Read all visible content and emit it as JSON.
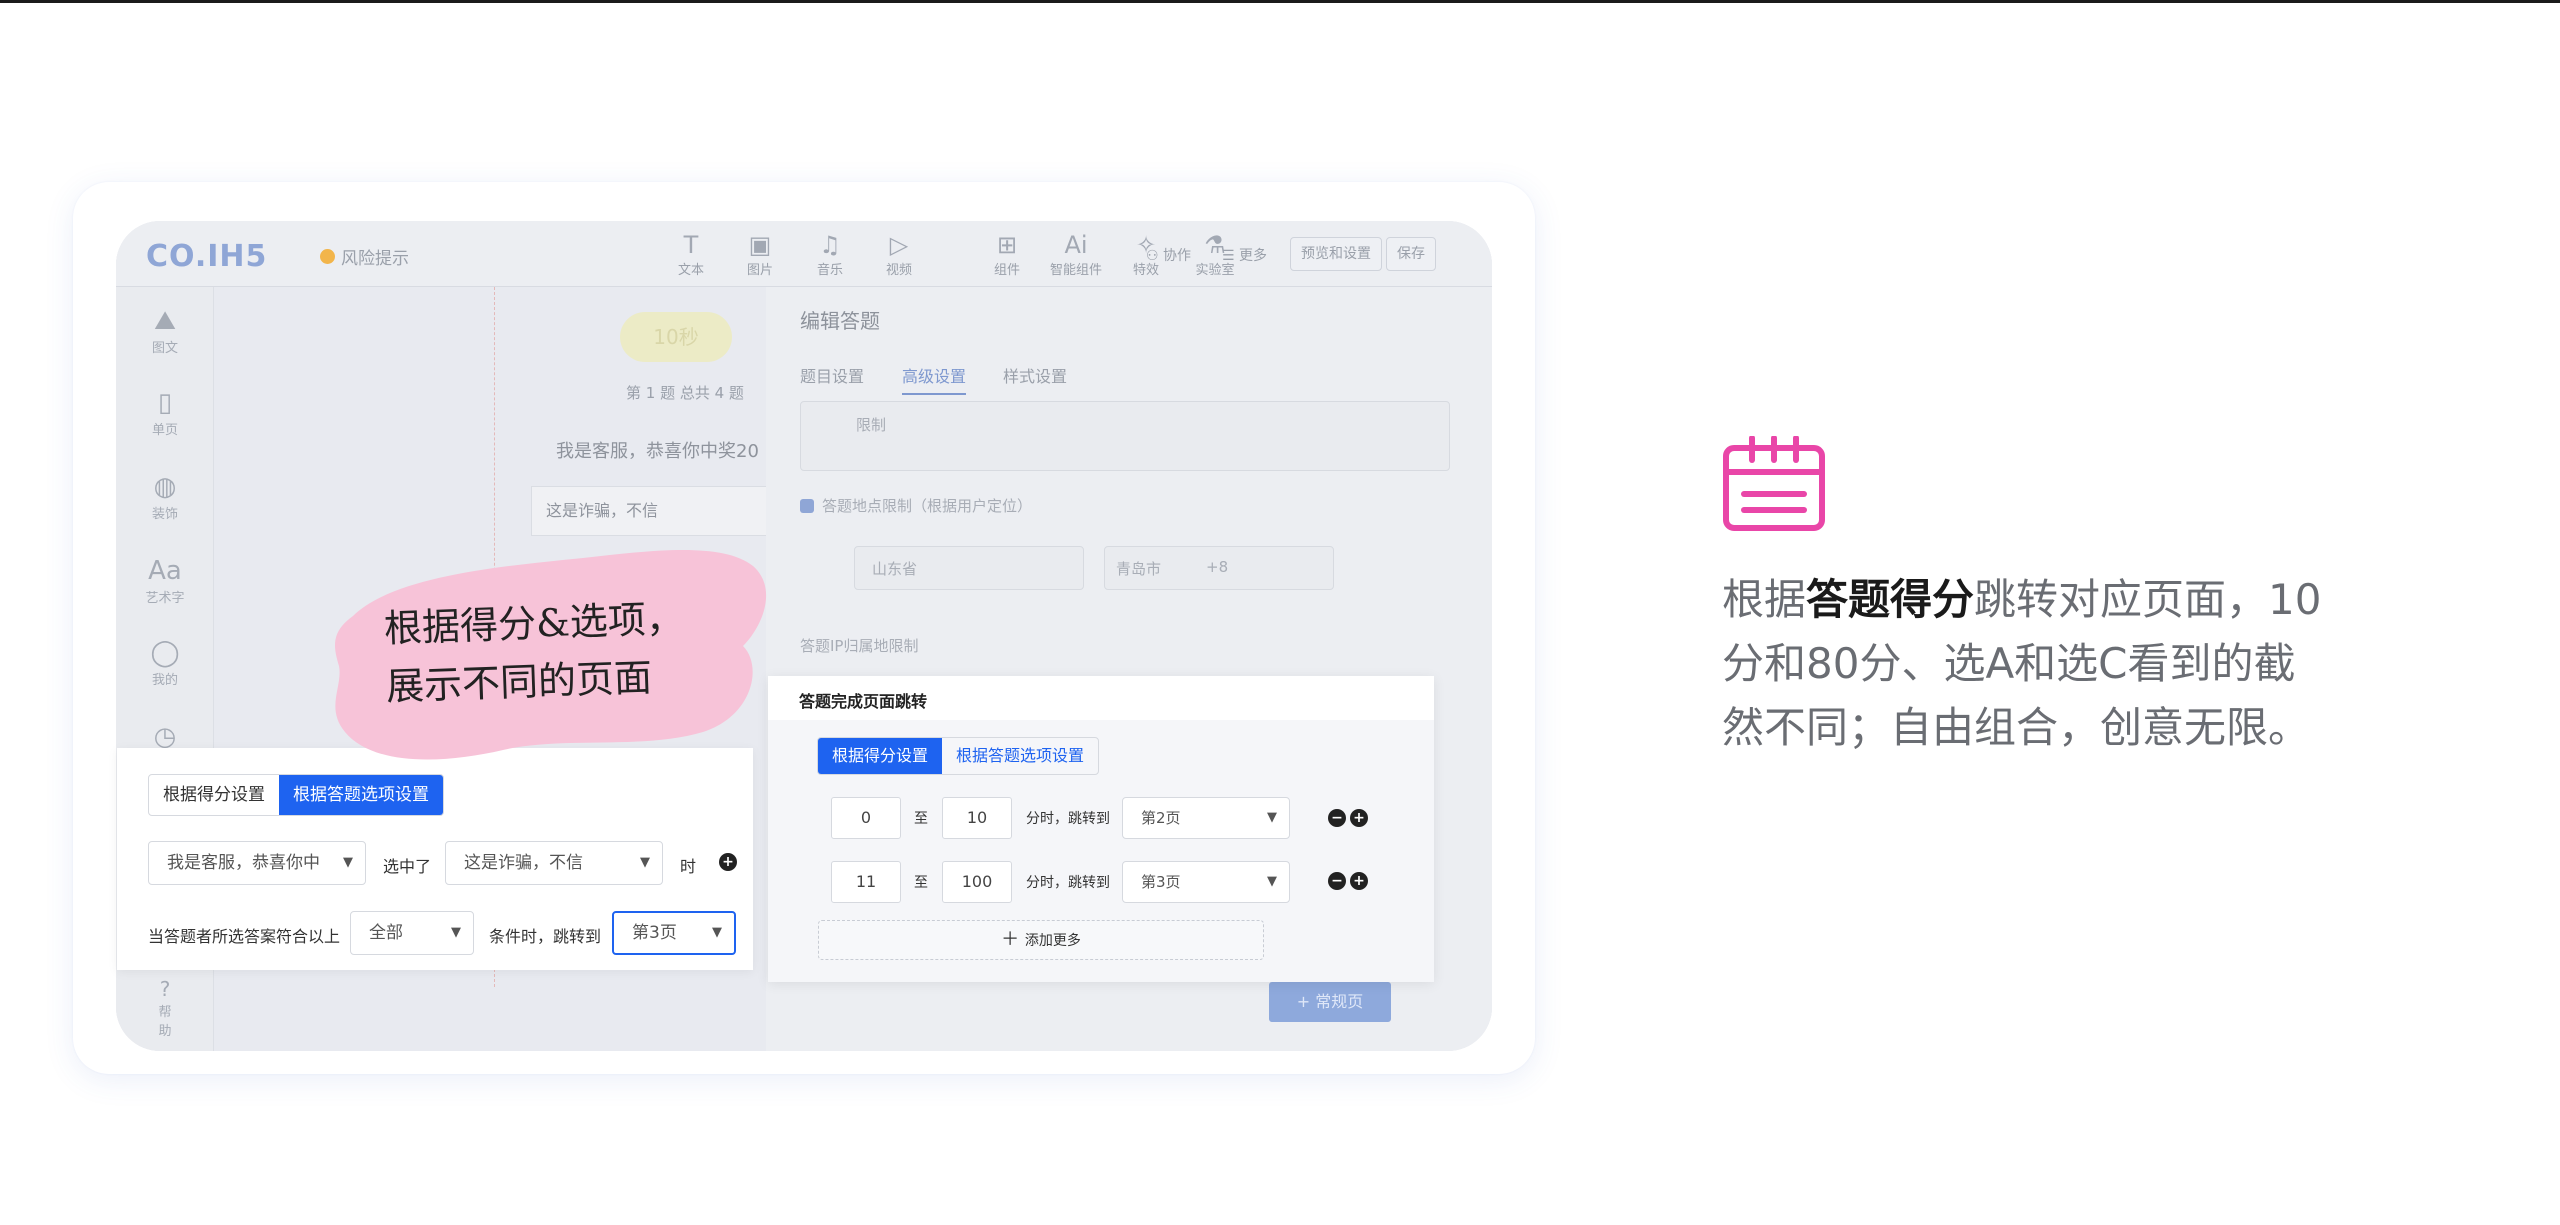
{
  "editor": {
    "logo": "CO.IH5",
    "risk_label": "风险提示",
    "tools": [
      {
        "label": "文本",
        "icon": "text-icon",
        "glyph": "T"
      },
      {
        "label": "图片",
        "icon": "image-icon",
        "glyph": "▣"
      },
      {
        "label": "音乐",
        "icon": "music-icon",
        "glyph": "♫"
      },
      {
        "label": "视频",
        "icon": "video-icon",
        "glyph": "▷"
      },
      {
        "label": "组件",
        "icon": "component-icon",
        "glyph": "⊞"
      },
      {
        "label": "智能组件",
        "icon": "ai-component-icon",
        "glyph": "Ai"
      },
      {
        "label": "特效",
        "icon": "effects-icon",
        "glyph": "✧"
      },
      {
        "label": "实验室",
        "icon": "lab-icon",
        "glyph": "⚗"
      }
    ],
    "collab_label": "协作",
    "more_label": "更多",
    "preview_settings_label": "预览和设置",
    "save_label": "保存",
    "sidebar": [
      {
        "label": "图文",
        "icon": "graphic-text-icon",
        "glyph": "⛰"
      },
      {
        "label": "单页",
        "icon": "single-page-icon",
        "glyph": "▯"
      },
      {
        "label": "装饰",
        "icon": "palette-icon",
        "glyph": "◍"
      },
      {
        "label": "艺术字",
        "icon": "art-text-icon",
        "glyph": "Aa"
      },
      {
        "label": "我的",
        "icon": "user-icon",
        "glyph": "◯"
      },
      {
        "label": "",
        "icon": "clock-icon",
        "glyph": "◷"
      }
    ],
    "help_label": "帮助",
    "preview": {
      "timer": "10秒",
      "question_index": "第 1 题 总共 4 题",
      "question_text": "我是客服，恭喜你中奖20",
      "option_1": "这是诈骗，不信"
    },
    "panel": {
      "title": "编辑答题",
      "tabs": [
        "题目设置",
        "高级设置",
        "样式设置"
      ],
      "limit_label": "限制",
      "location_label": "答题地点限制（根据用户定位）",
      "province": "山东省",
      "city": "青岛市",
      "city_extra": "+8",
      "ip_label": "答题IP归属地限制"
    },
    "bottom_button": "+ 常规页"
  },
  "blob_text": [
    "根据得分&选项，",
    "展示不同的页面"
  ],
  "option_popup": {
    "tabs": [
      "根据得分设置",
      "根据答题选项设置"
    ],
    "active_tab": 1,
    "question_select": "我是客服，恭喜你中",
    "selected_label": "选中了",
    "answer_select": "这是诈骗，不信",
    "time_label": "时",
    "condition_prefix": "当答题者所选答案符合以上",
    "condition_select": "全部",
    "condition_suffix": "条件时，跳转到",
    "target_select": "第3页"
  },
  "score_popup": {
    "title": "答题完成页面跳转",
    "tabs": [
      "根据得分设置",
      "根据答题选项设置"
    ],
    "active_tab": 0,
    "rows": [
      {
        "from": "0",
        "to": "10",
        "target": "第2页"
      },
      {
        "from": "11",
        "to": "100",
        "target": "第3页"
      }
    ],
    "to_label": "至",
    "jump_label": "分时，跳转到",
    "add_more_label": "添加更多"
  },
  "feature": {
    "icon": "calendar-icon",
    "text_pre": "根据",
    "text_bold": "答题得分",
    "text_post": "跳转对应页面，10分和80分、选A和选C看到的截然不同；自由组合，创意无限。"
  },
  "colors": {
    "accent": "#1e63f0",
    "pink": "#f7c3d8",
    "feature_icon": "#e946a8"
  }
}
